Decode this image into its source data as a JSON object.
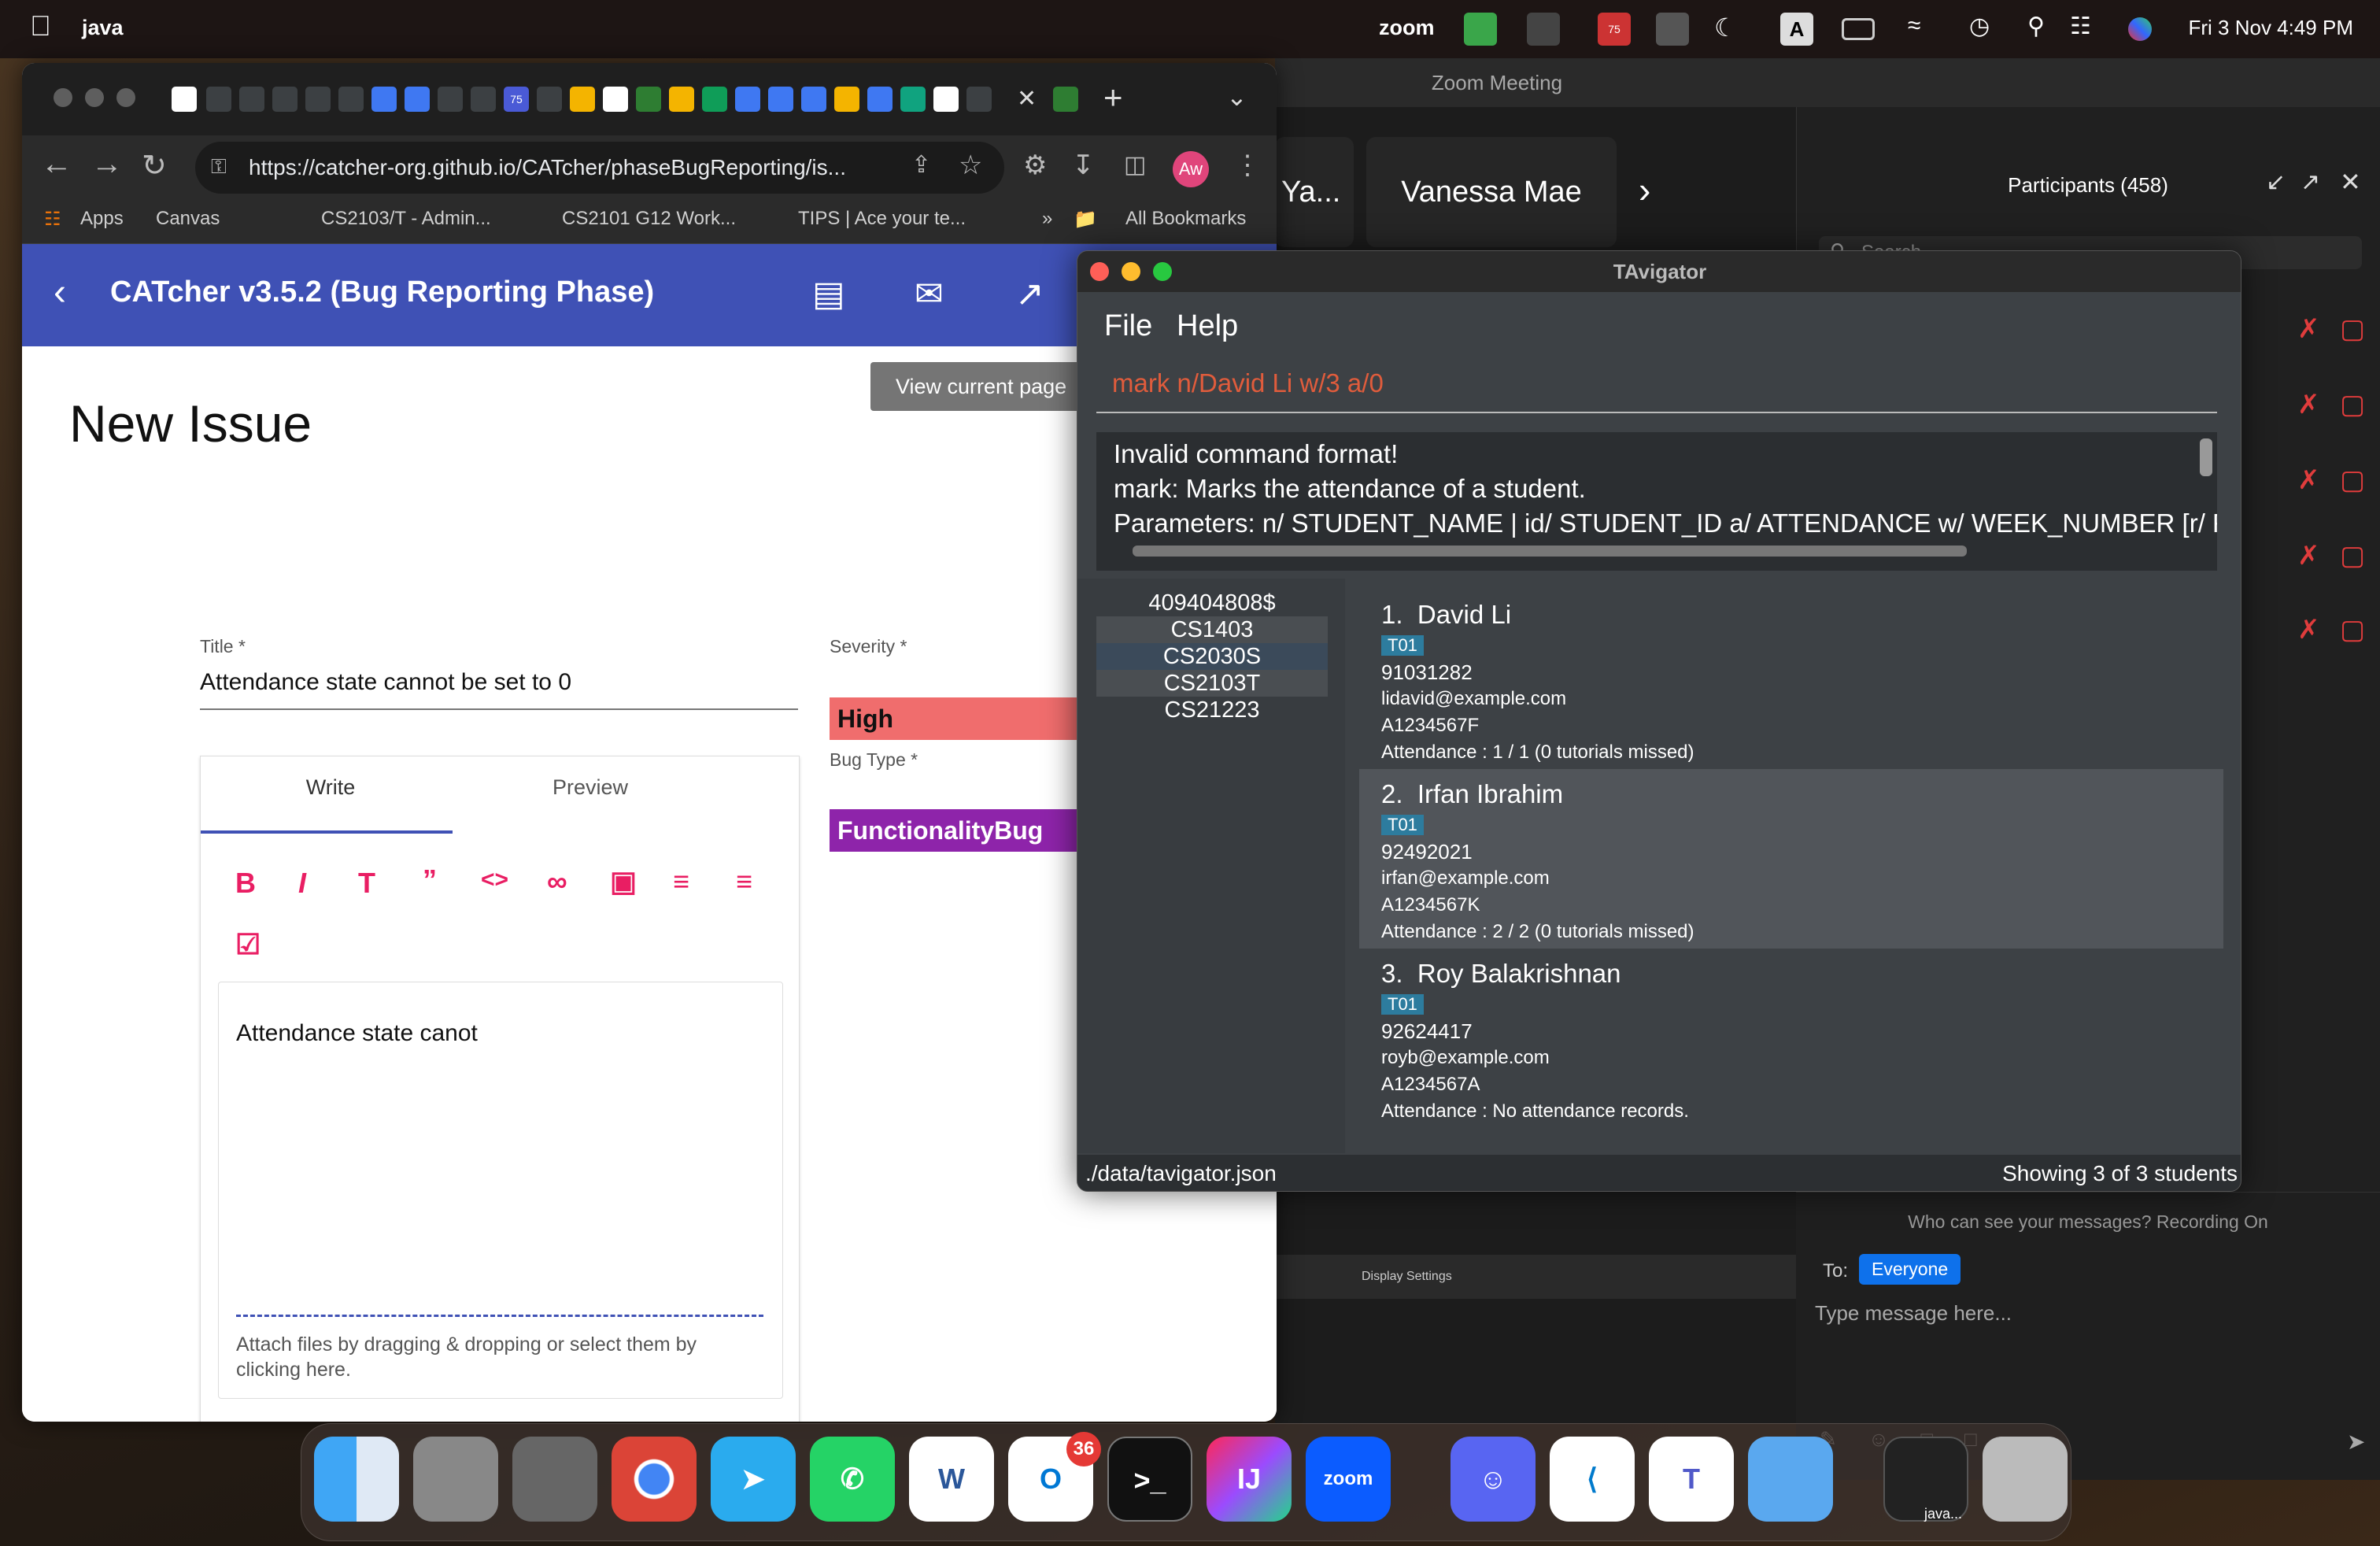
{
  "menubar": {
    "app_name": "java",
    "zoom_label": "zoom",
    "clock": "Fri 3 Nov  4:49 PM",
    "badge": "75"
  },
  "zoom": {
    "window_title": "Zoom Meeting",
    "tiles": [
      "Ya...",
      "Vanessa Mae"
    ],
    "participants_title": "Participants (458)",
    "search_placeholder": "Search",
    "chat_recording": "Who can see your messages? Recording On",
    "chat_to": "To:",
    "chat_recipient": "Everyone",
    "chat_placeholder": "Type message here...",
    "share_label": "Display Settings",
    "pm_label": "PM"
  },
  "chrome": {
    "url": "https://catcher-org.github.io/CATcher/phaseBugReporting/is...",
    "profile": "Aw",
    "bookmarks": [
      "Apps",
      "Canvas",
      "CS2103/T - Admin...",
      "CS2101 G12 Work...",
      "TIPS | Ace your te...",
      "»",
      "All Bookmarks"
    ],
    "tab_badge": "75"
  },
  "catcher": {
    "app_title": "CATcher v3.5.2  (Bug Reporting Phase)",
    "view_page_button": "View current page",
    "page_heading": "New Issue",
    "title_label": "Title *",
    "title_value": "Attendance state cannot be set to 0",
    "severity_label": "Severity *",
    "severity_value": "High",
    "bugtype_label": "Bug Type *",
    "bugtype_value": "FunctionalityBug",
    "tab_write": "Write",
    "tab_preview": "Preview",
    "editor_text": "Attendance state canot",
    "attach_hint": "Attach files by dragging & dropping or select them by clicking here."
  },
  "tavigator": {
    "window_title": "TAvigator",
    "menu": [
      "File",
      "Help"
    ],
    "command": "mark n/David Li w/3 a/0",
    "result_lines": [
      "Invalid command format!",
      "mark: Marks the attendance of a student.",
      "Parameters: n/ STUDENT_NAME | id/ STUDENT_ID a/ ATTENDANCE w/ WEEK_NUMBER [r/ RI"
    ],
    "courses": [
      "409404808$",
      "CS1403",
      "CS2030S",
      "CS2103T",
      "CS21223"
    ],
    "students": [
      {
        "index": "1.",
        "name": "David Li",
        "tag": "T01",
        "phone": "91031282",
        "email": "lidavid@example.com",
        "id": "A1234567F",
        "attendance": "Attendance : 1 / 1 (0 tutorials missed)"
      },
      {
        "index": "2.",
        "name": "Irfan Ibrahim",
        "tag": "T01",
        "phone": "92492021",
        "email": "irfan@example.com",
        "id": "A1234567K",
        "attendance": "Attendance : 2 / 2 (0 tutorials missed)"
      },
      {
        "index": "3.",
        "name": "Roy Balakrishnan",
        "tag": "T01",
        "phone": "92624417",
        "email": "royb@example.com",
        "id": "A1234567A",
        "attendance": "Attendance : No attendance records."
      }
    ],
    "status_left": "./data/tavigator.json",
    "status_right": "Showing 3 of 3 students"
  },
  "dock": {
    "outlook_badge": "36",
    "java_label": "java...",
    "zoom_label": "zoom"
  },
  "colors": {
    "catcher_primary": "#3f51b5",
    "severity_high": "#f06d6d",
    "bugtype": "#8e24aa",
    "cmd_text": "#e05c3c",
    "zoom_blue": "#0e71eb"
  }
}
